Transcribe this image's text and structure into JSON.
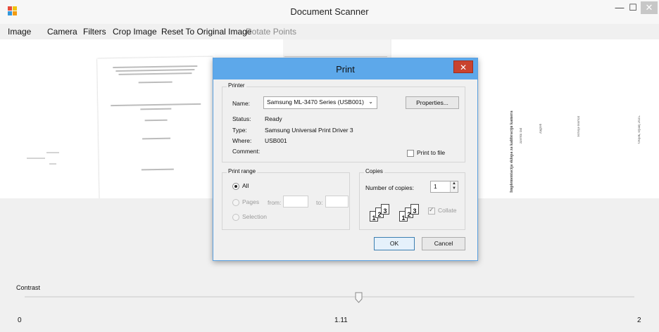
{
  "window": {
    "title": "Document Scanner",
    "minimize_glyph": "—",
    "maximize_glyph": "☐",
    "close_glyph": "✕"
  },
  "menu": {
    "items": [
      "Image",
      "Camera",
      "Filters",
      "Crop Image",
      "Reset To Original Image",
      "Rotate Points"
    ],
    "disabled": [
      "Rotate Points"
    ]
  },
  "document_preview": {
    "rotated_lines": [
      "Implementacija sklopa za kalibraciju kamera",
      "završni rad",
      "Zagreb",
      "Hrvoje Horvat",
      "Osijek, srpanj 2025."
    ]
  },
  "print_dialog": {
    "title": "Print",
    "close_glyph": "✕",
    "printer_group": "Printer",
    "name_label": "Name:",
    "printer_name": "Samsung ML-3470 Series (USB001)",
    "properties_button": "Properties...",
    "status_label": "Status:",
    "status_value": "Ready",
    "type_label": "Type:",
    "type_value": "Samsung Universal Print Driver 3",
    "where_label": "Where:",
    "where_value": "USB001",
    "comment_label": "Comment:",
    "print_to_file_label": "Print to file",
    "print_to_file_checked": false,
    "print_range_group": "Print range",
    "range_all": "All",
    "range_pages": "Pages",
    "range_from": "from:",
    "range_to": "to:",
    "range_selection": "Selection",
    "copies_group": "Copies",
    "number_of_copies_label": "Number of copies:",
    "number_of_copies": "1",
    "collate_label": "Collate",
    "collate_checked": true,
    "ok_button": "OK",
    "cancel_button": "Cancel"
  },
  "contrast": {
    "label": "Contrast",
    "min": "0",
    "value": "1.11",
    "max": "2",
    "value_number": 1.11,
    "range": [
      0,
      2
    ]
  },
  "colors": {
    "dialog_title_bar": "#5da8ea",
    "close_button": "#c9432e",
    "window_bg": "#f0f0f0"
  }
}
